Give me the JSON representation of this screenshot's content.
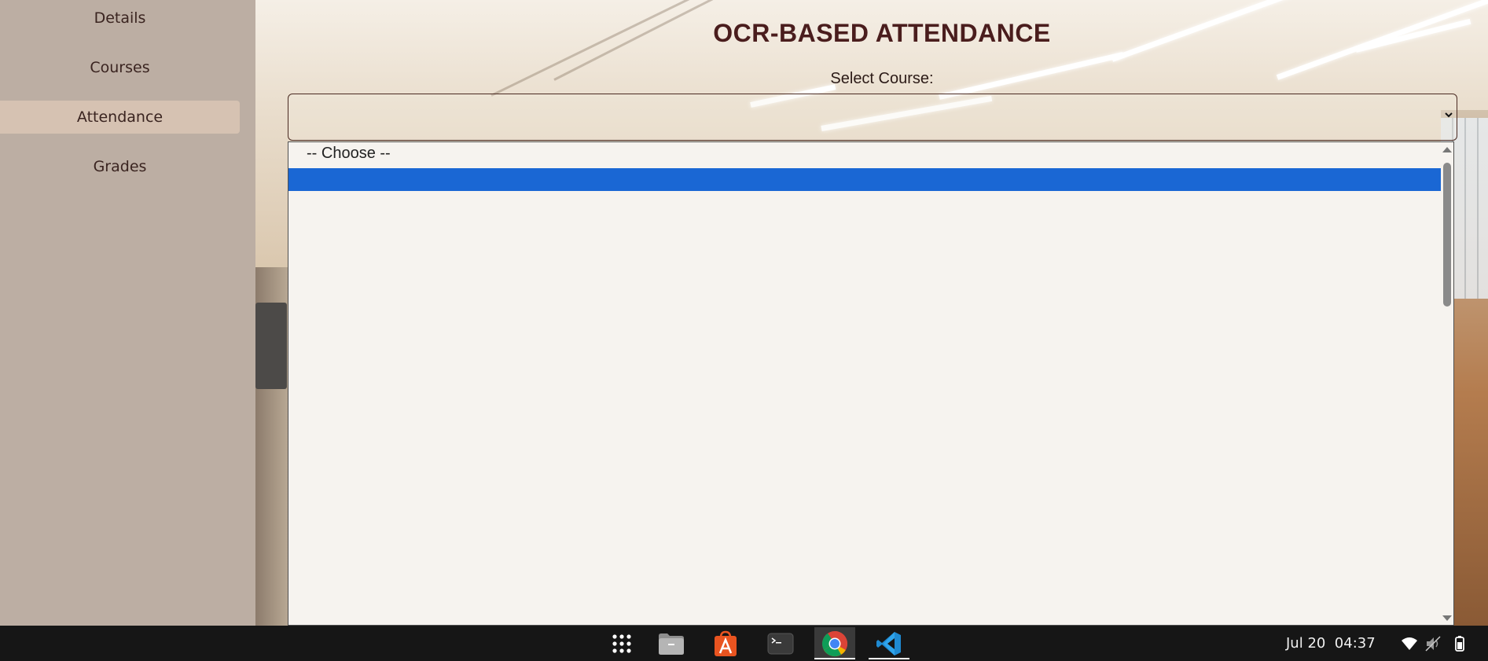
{
  "sidebar": {
    "items": [
      {
        "label": "Details"
      },
      {
        "label": "Courses"
      },
      {
        "label": "Attendance",
        "active": true
      },
      {
        "label": "Grades"
      }
    ]
  },
  "main": {
    "title": "OCR-BASED ATTENDANCE",
    "select_label": "Select Course:",
    "select_value": "",
    "options": [
      "-- Choose --",
      ""
    ],
    "highlighted_option_index": 1
  },
  "taskbar": {
    "apps": [
      {
        "icon": "app-grid-icon"
      },
      {
        "icon": "files-icon"
      },
      {
        "icon": "app-store-icon"
      },
      {
        "icon": "terminal-icon"
      },
      {
        "icon": "chrome-icon",
        "active": true
      },
      {
        "icon": "vscode-icon",
        "running": true
      }
    ],
    "clock": "Jul 20  04:37",
    "tray": [
      "wifi-icon",
      "volume-muted-icon",
      "battery-icon"
    ]
  },
  "colors": {
    "sidebar_bg": "#bcaea3",
    "sidebar_active": "#d6c2b2",
    "title_color": "#4a1d1d",
    "highlight": "#1a67d4",
    "taskbar_bg": "#161616"
  }
}
